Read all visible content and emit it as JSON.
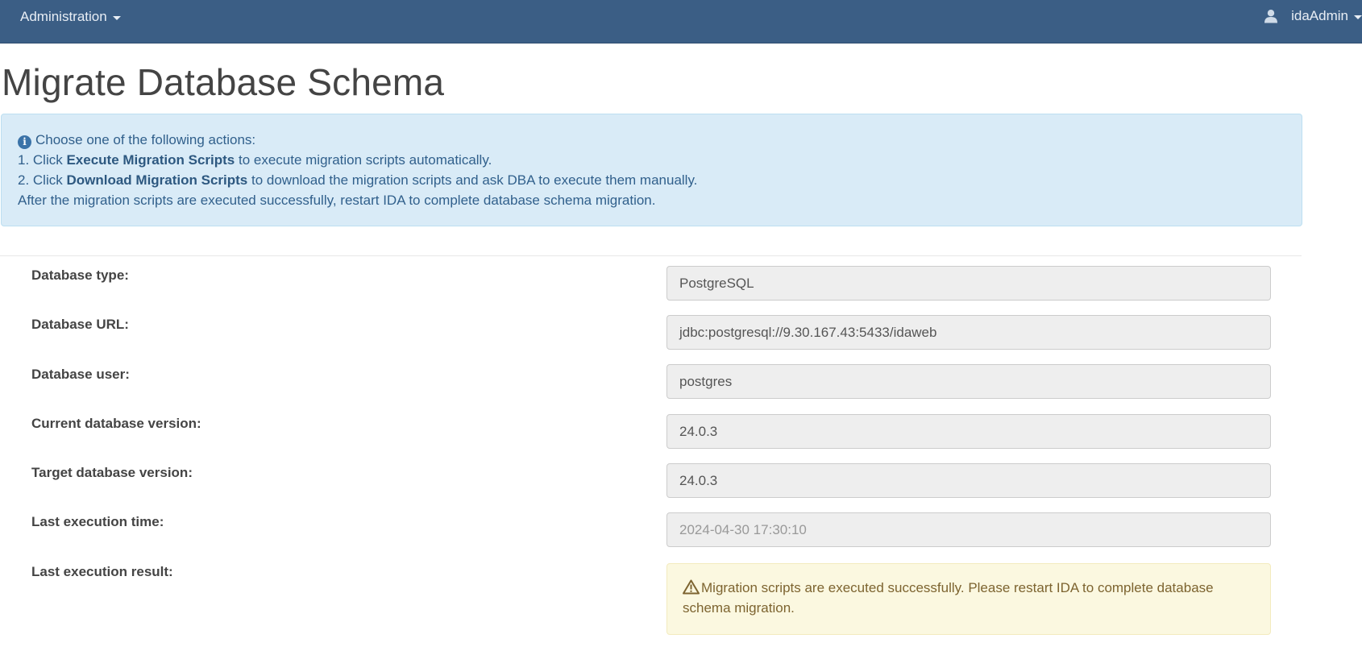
{
  "navbar": {
    "menu_label": "Administration",
    "user_label": "idaAdmin",
    "user_icon": "user-icon"
  },
  "page": {
    "title": "Migrate Database Schema"
  },
  "info": {
    "icon": "info-icon",
    "intro": "Choose one of the following actions:",
    "line1_prefix": "1. Click ",
    "line1_bold": "Execute Migration Scripts",
    "line1_suffix": " to execute migration scripts automatically.",
    "line2_prefix": "2. Click ",
    "line2_bold": "Download Migration Scripts",
    "line2_suffix": " to download the migration scripts and ask DBA to execute them manually.",
    "line3": "After the migration scripts are executed successfully, restart IDA to complete database schema migration."
  },
  "form": {
    "db_type_label": "Database type:",
    "db_type_value": "PostgreSQL",
    "db_url_label": "Database URL:",
    "db_url_value": "jdbc:postgresql://9.30.167.43:5433/idaweb",
    "db_user_label": "Database user:",
    "db_user_value": "postgres",
    "current_version_label": "Current database version:",
    "current_version_value": "24.0.3",
    "target_version_label": "Target database version:",
    "target_version_value": "24.0.3",
    "last_exec_time_label": "Last execution time:",
    "last_exec_time_value": "2024-04-30 17:30:10",
    "last_exec_result_label": "Last execution result:",
    "last_exec_result_icon": "warning-icon",
    "last_exec_result_text": "Migration scripts are executed successfully. Please restart IDA to complete database schema migration."
  },
  "colors": {
    "navbar": "#3b5e85",
    "info_bg": "#d9ebf7",
    "warning_bg": "#fbf8e0"
  }
}
